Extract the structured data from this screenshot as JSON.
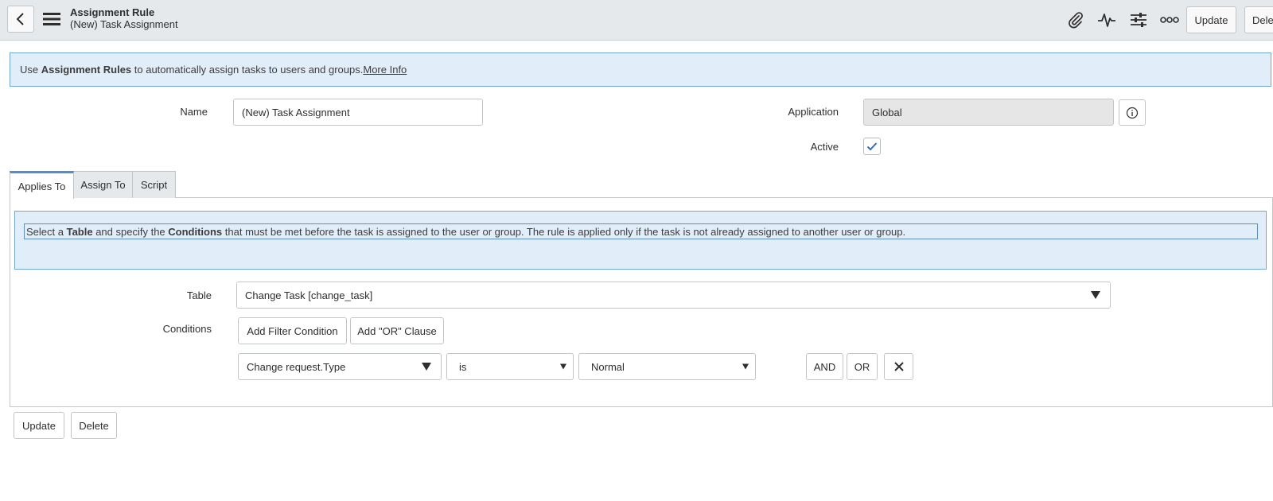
{
  "header": {
    "title": "Assignment Rule",
    "subtitle": "(New) Task Assignment",
    "update_label": "Update",
    "delete_label": "Dele"
  },
  "banner": {
    "prefix": "Use ",
    "bold": "Assignment Rules",
    "suffix": " to automatically assign tasks to users and groups.",
    "link": "More Info"
  },
  "form": {
    "name_label": "Name",
    "name_value": "(New) Task Assignment",
    "application_label": "Application",
    "application_value": "Global",
    "active_label": "Active",
    "active_checked": true
  },
  "tabs": [
    {
      "label": "Applies To",
      "active": true
    },
    {
      "label": "Assign To",
      "active": false
    },
    {
      "label": "Script",
      "active": false
    }
  ],
  "applies_to": {
    "help": {
      "p1": "Select a ",
      "b1": "Table",
      "p2": " and specify the ",
      "b2": "Conditions",
      "p3": " that must be met before the task is assigned to the user or group. The rule is applied only if the task is not already assigned to another user or group."
    },
    "table_label": "Table",
    "table_value": "Change Task [change_task]",
    "conditions_label": "Conditions",
    "add_filter_label": "Add Filter Condition",
    "add_or_label": "Add \"OR\" Clause",
    "condition": {
      "field": "Change request.Type",
      "operator": "is",
      "value": "Normal",
      "and_label": "AND",
      "or_label": "OR"
    }
  },
  "footer": {
    "update_label": "Update",
    "delete_label": "Delete"
  },
  "colors": {
    "accent": "#4d8fd1",
    "banner_bg": "#e1eef9",
    "header_bg": "#e6e9eb"
  }
}
